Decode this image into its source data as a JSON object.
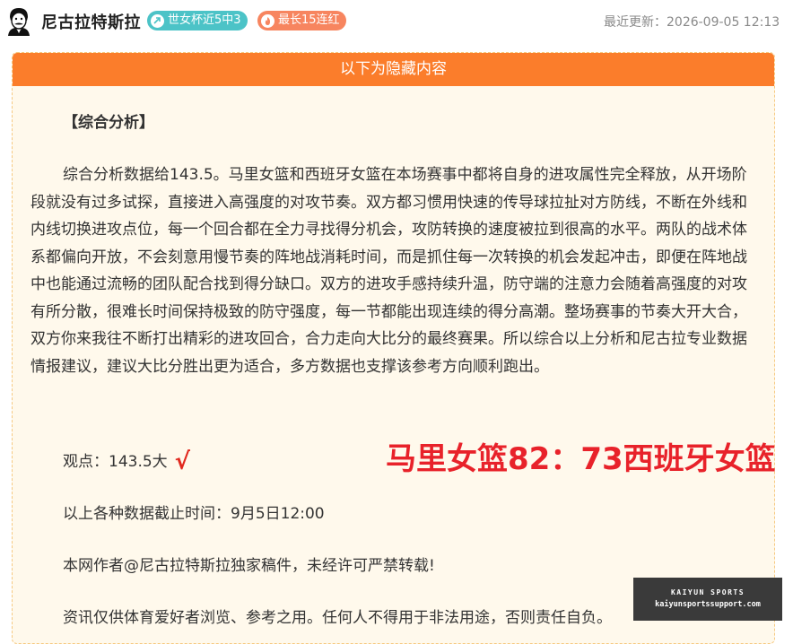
{
  "header": {
    "author_name": "尼古拉特斯拉",
    "badges": [
      {
        "label": "世女杯近5中3",
        "color": "#4cc3c7",
        "icon": "arrow-up-icon"
      },
      {
        "label": "最长15连红",
        "color": "#f7855f",
        "icon": "fire-icon"
      }
    ],
    "update_time": "最近更新：2026-09-05 12:13"
  },
  "hidden_section": {
    "bar_label": "以下为隐藏内容",
    "accent_color": "#fb7d2b"
  },
  "article": {
    "section_title": "【综合分析】",
    "paragraph": "综合分析数据给143.5。马里女篮和西班牙女篮在本场赛事中都将自身的进攻属性完全释放，从开场阶段就没有过多试探，直接进入高强度的对攻节奏。双方都习惯用快速的传导球拉扯对方防线，不断在外线和内线切换进攻点位，每一个回合都在全力寻找得分机会，攻防转换的速度被拉到很高的水平。两队的战术体系都偏向开放，不会刻意用慢节奏的阵地战消耗时间，而是抓住每一次转换的机会发起冲击，即便在阵地战中也能通过流畅的团队配合找到得分缺口。双方的进攻手感持续升温，防守端的注意力会随着高强度的对攻有所分散，很难长时间保持极致的防守强度，每一节都能出现连续的得分高潮。整场赛事的节奏大开大合，双方你来我往不断打出精彩的进攻回合，合力走向大比分的最终赛果。所以综合以上分析和尼古拉专业数据情报建议，建议大比分胜出更为适合，多方数据也支撑该参考方向顺利跑出。",
    "viewpoint": "观点：143.5大",
    "check_mark": "√",
    "cutoff": "以上各种数据截止时间：9月5日12:00",
    "copyright": "本网作者@尼古拉特斯拉独家稿件，未经许可严禁转载!",
    "disclaimer": "资讯仅供体育爱好者浏览、参考之用。任何人不得用于非法用途，否则责任自负。"
  },
  "score_overlay": "马里女篮82：73西班牙女篮",
  "watermark": {
    "line1": "KAIYUN SPORTS",
    "line2": "kaiyunsportssupport.com"
  }
}
